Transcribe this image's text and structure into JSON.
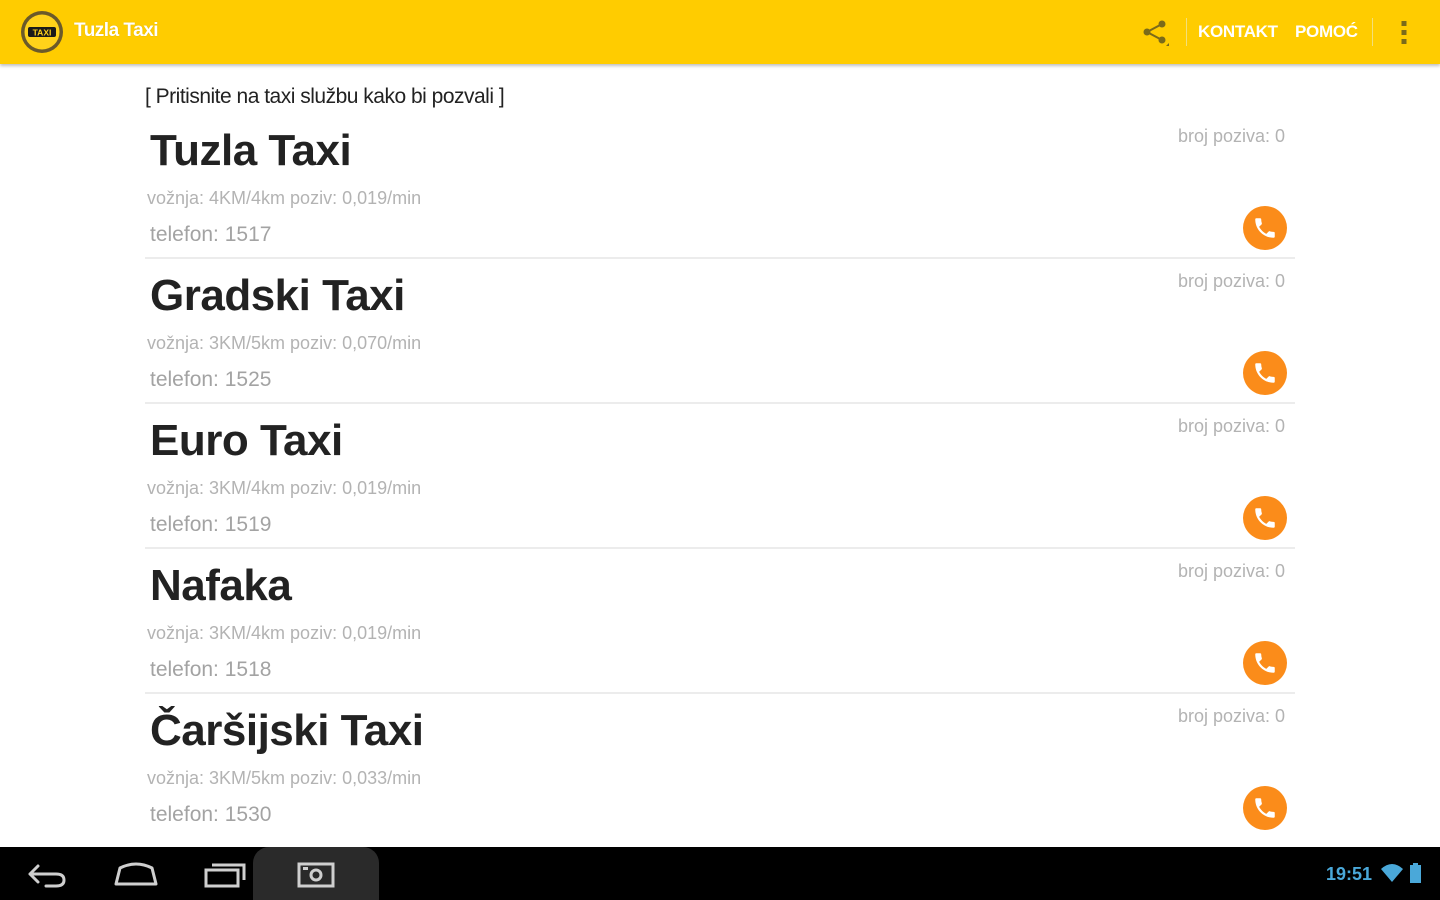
{
  "action_bar": {
    "logo_text": "TAXI",
    "title": "Tuzla Taxi",
    "share_icon": "share-icon",
    "actions": [
      "KONTAKT",
      "POMOĆ"
    ],
    "overflow_icon": "overflow-menu-icon",
    "color": "#ffcc00"
  },
  "hint": "[ Pritisnite na taxi službu kako bi pozvali ]",
  "taxis": [
    {
      "name": "Tuzla Taxi",
      "tariff": "vožnja: 4KM/4km poziv: 0,019/min",
      "phone": "telefon: 1517",
      "calls": "broj poziva: 0"
    },
    {
      "name": "Gradski Taxi",
      "tariff": "vožnja: 3KM/5km poziv: 0,070/min",
      "phone": "telefon: 1525",
      "calls": "broj poziva: 0"
    },
    {
      "name": "Euro Taxi",
      "tariff": "vožnja: 3KM/4km poziv: 0,019/min",
      "phone": "telefon: 1519",
      "calls": "broj poziva: 0"
    },
    {
      "name": "Nafaka",
      "tariff": "vožnja: 3KM/4km poziv: 0,019/min",
      "phone": "telefon: 1518",
      "calls": "broj poziva: 0"
    },
    {
      "name": "Čaršijski Taxi",
      "tariff": "vožnja: 3KM/5km poziv: 0,033/min",
      "phone": "telefon: 1530",
      "calls": "broj poziva: 0"
    }
  ],
  "call_button_color": "#fb8c1a",
  "system_bar": {
    "buttons": [
      "back-icon",
      "home-icon",
      "recent-apps-icon",
      "screenshot-icon"
    ],
    "time": "19:51",
    "status_icons": [
      "wifi-icon",
      "battery-icon"
    ]
  }
}
